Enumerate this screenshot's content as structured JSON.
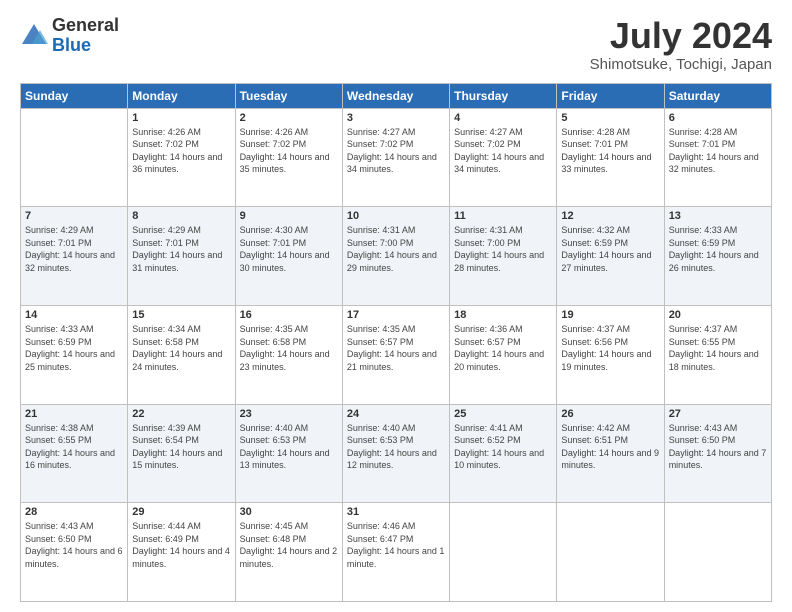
{
  "logo": {
    "general": "General",
    "blue": "Blue"
  },
  "title": {
    "month_year": "July 2024",
    "location": "Shimotsuke, Tochigi, Japan"
  },
  "days_of_week": [
    "Sunday",
    "Monday",
    "Tuesday",
    "Wednesday",
    "Thursday",
    "Friday",
    "Saturday"
  ],
  "weeks": [
    [
      {
        "day": "",
        "sunrise": "",
        "sunset": "",
        "daylight": ""
      },
      {
        "day": "1",
        "sunrise": "Sunrise: 4:26 AM",
        "sunset": "Sunset: 7:02 PM",
        "daylight": "Daylight: 14 hours and 36 minutes."
      },
      {
        "day": "2",
        "sunrise": "Sunrise: 4:26 AM",
        "sunset": "Sunset: 7:02 PM",
        "daylight": "Daylight: 14 hours and 35 minutes."
      },
      {
        "day": "3",
        "sunrise": "Sunrise: 4:27 AM",
        "sunset": "Sunset: 7:02 PM",
        "daylight": "Daylight: 14 hours and 34 minutes."
      },
      {
        "day": "4",
        "sunrise": "Sunrise: 4:27 AM",
        "sunset": "Sunset: 7:02 PM",
        "daylight": "Daylight: 14 hours and 34 minutes."
      },
      {
        "day": "5",
        "sunrise": "Sunrise: 4:28 AM",
        "sunset": "Sunset: 7:01 PM",
        "daylight": "Daylight: 14 hours and 33 minutes."
      },
      {
        "day": "6",
        "sunrise": "Sunrise: 4:28 AM",
        "sunset": "Sunset: 7:01 PM",
        "daylight": "Daylight: 14 hours and 32 minutes."
      }
    ],
    [
      {
        "day": "7",
        "sunrise": "Sunrise: 4:29 AM",
        "sunset": "Sunset: 7:01 PM",
        "daylight": "Daylight: 14 hours and 32 minutes."
      },
      {
        "day": "8",
        "sunrise": "Sunrise: 4:29 AM",
        "sunset": "Sunset: 7:01 PM",
        "daylight": "Daylight: 14 hours and 31 minutes."
      },
      {
        "day": "9",
        "sunrise": "Sunrise: 4:30 AM",
        "sunset": "Sunset: 7:01 PM",
        "daylight": "Daylight: 14 hours and 30 minutes."
      },
      {
        "day": "10",
        "sunrise": "Sunrise: 4:31 AM",
        "sunset": "Sunset: 7:00 PM",
        "daylight": "Daylight: 14 hours and 29 minutes."
      },
      {
        "day": "11",
        "sunrise": "Sunrise: 4:31 AM",
        "sunset": "Sunset: 7:00 PM",
        "daylight": "Daylight: 14 hours and 28 minutes."
      },
      {
        "day": "12",
        "sunrise": "Sunrise: 4:32 AM",
        "sunset": "Sunset: 6:59 PM",
        "daylight": "Daylight: 14 hours and 27 minutes."
      },
      {
        "day": "13",
        "sunrise": "Sunrise: 4:33 AM",
        "sunset": "Sunset: 6:59 PM",
        "daylight": "Daylight: 14 hours and 26 minutes."
      }
    ],
    [
      {
        "day": "14",
        "sunrise": "Sunrise: 4:33 AM",
        "sunset": "Sunset: 6:59 PM",
        "daylight": "Daylight: 14 hours and 25 minutes."
      },
      {
        "day": "15",
        "sunrise": "Sunrise: 4:34 AM",
        "sunset": "Sunset: 6:58 PM",
        "daylight": "Daylight: 14 hours and 24 minutes."
      },
      {
        "day": "16",
        "sunrise": "Sunrise: 4:35 AM",
        "sunset": "Sunset: 6:58 PM",
        "daylight": "Daylight: 14 hours and 23 minutes."
      },
      {
        "day": "17",
        "sunrise": "Sunrise: 4:35 AM",
        "sunset": "Sunset: 6:57 PM",
        "daylight": "Daylight: 14 hours and 21 minutes."
      },
      {
        "day": "18",
        "sunrise": "Sunrise: 4:36 AM",
        "sunset": "Sunset: 6:57 PM",
        "daylight": "Daylight: 14 hours and 20 minutes."
      },
      {
        "day": "19",
        "sunrise": "Sunrise: 4:37 AM",
        "sunset": "Sunset: 6:56 PM",
        "daylight": "Daylight: 14 hours and 19 minutes."
      },
      {
        "day": "20",
        "sunrise": "Sunrise: 4:37 AM",
        "sunset": "Sunset: 6:55 PM",
        "daylight": "Daylight: 14 hours and 18 minutes."
      }
    ],
    [
      {
        "day": "21",
        "sunrise": "Sunrise: 4:38 AM",
        "sunset": "Sunset: 6:55 PM",
        "daylight": "Daylight: 14 hours and 16 minutes."
      },
      {
        "day": "22",
        "sunrise": "Sunrise: 4:39 AM",
        "sunset": "Sunset: 6:54 PM",
        "daylight": "Daylight: 14 hours and 15 minutes."
      },
      {
        "day": "23",
        "sunrise": "Sunrise: 4:40 AM",
        "sunset": "Sunset: 6:53 PM",
        "daylight": "Daylight: 14 hours and 13 minutes."
      },
      {
        "day": "24",
        "sunrise": "Sunrise: 4:40 AM",
        "sunset": "Sunset: 6:53 PM",
        "daylight": "Daylight: 14 hours and 12 minutes."
      },
      {
        "day": "25",
        "sunrise": "Sunrise: 4:41 AM",
        "sunset": "Sunset: 6:52 PM",
        "daylight": "Daylight: 14 hours and 10 minutes."
      },
      {
        "day": "26",
        "sunrise": "Sunrise: 4:42 AM",
        "sunset": "Sunset: 6:51 PM",
        "daylight": "Daylight: 14 hours and 9 minutes."
      },
      {
        "day": "27",
        "sunrise": "Sunrise: 4:43 AM",
        "sunset": "Sunset: 6:50 PM",
        "daylight": "Daylight: 14 hours and 7 minutes."
      }
    ],
    [
      {
        "day": "28",
        "sunrise": "Sunrise: 4:43 AM",
        "sunset": "Sunset: 6:50 PM",
        "daylight": "Daylight: 14 hours and 6 minutes."
      },
      {
        "day": "29",
        "sunrise": "Sunrise: 4:44 AM",
        "sunset": "Sunset: 6:49 PM",
        "daylight": "Daylight: 14 hours and 4 minutes."
      },
      {
        "day": "30",
        "sunrise": "Sunrise: 4:45 AM",
        "sunset": "Sunset: 6:48 PM",
        "daylight": "Daylight: 14 hours and 2 minutes."
      },
      {
        "day": "31",
        "sunrise": "Sunrise: 4:46 AM",
        "sunset": "Sunset: 6:47 PM",
        "daylight": "Daylight: 14 hours and 1 minute."
      },
      {
        "day": "",
        "sunrise": "",
        "sunset": "",
        "daylight": ""
      },
      {
        "day": "",
        "sunrise": "",
        "sunset": "",
        "daylight": ""
      },
      {
        "day": "",
        "sunrise": "",
        "sunset": "",
        "daylight": ""
      }
    ]
  ]
}
